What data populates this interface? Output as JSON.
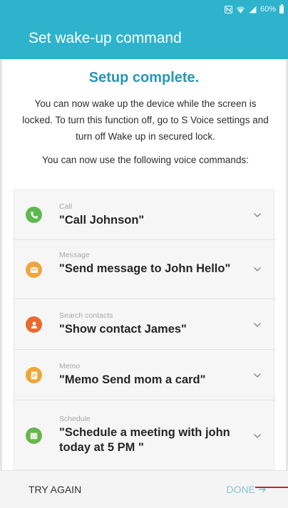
{
  "status_bar": {
    "battery": "60%",
    "icons": [
      "nfc-icon",
      "wifi-icon",
      "signal-icon",
      "battery-icon"
    ]
  },
  "app_bar": {
    "title": "Set wake-up command",
    "color": "#2eb3cc"
  },
  "setup": {
    "heading": "Setup complete.",
    "body": "You can now wake up the device while the screen is locked. To turn this function off, go to S Voice settings and turn off Wake up in secured lock.",
    "hint": "You can now use the following voice commands:"
  },
  "commands": [
    {
      "category": "Call",
      "command": "\"Call Johnson\"",
      "icon": "phone-icon",
      "color": "#5db94e"
    },
    {
      "category": "Message",
      "command": "\"Send message to John Hello\"",
      "icon": "envelope-icon",
      "color": "#f1a53b"
    },
    {
      "category": "Search contacts",
      "command": "\"Show contact James\"",
      "icon": "contact-icon",
      "color": "#e86a2f"
    },
    {
      "category": "Memo",
      "command": "\"Memo Send mom a card\"",
      "icon": "memo-icon",
      "color": "#f0a636"
    },
    {
      "category": "Schedule",
      "command": "\"Schedule a meeting with john today at 5 PM \"",
      "icon": "calendar-icon",
      "color": "#66b74b"
    }
  ],
  "footer": {
    "try_again": "TRY AGAIN",
    "done": "DONE"
  }
}
